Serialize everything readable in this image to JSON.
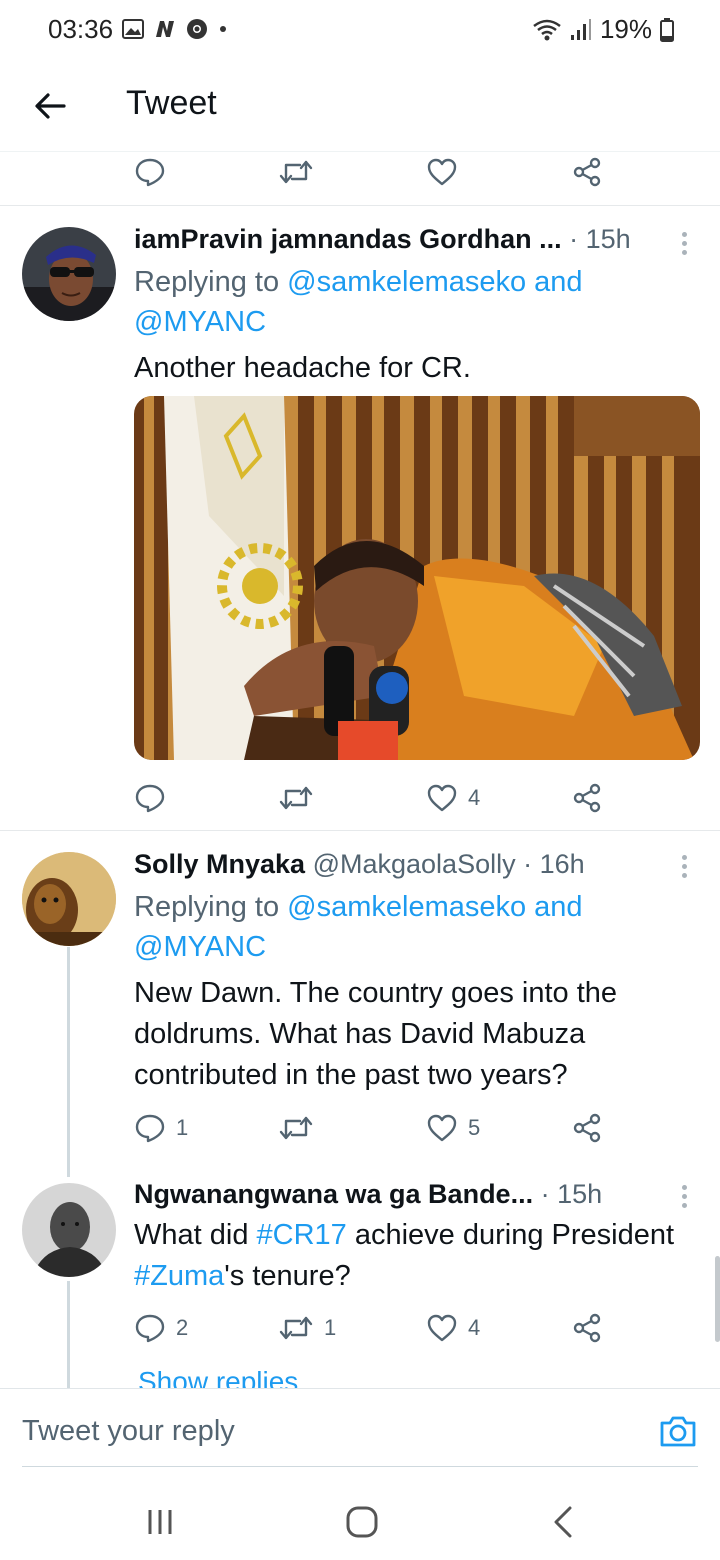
{
  "status_bar": {
    "time": "03:36",
    "battery": "19%",
    "icons": [
      "image-icon",
      "n-icon",
      "chrome-icon",
      "dot-icon",
      "wifi-icon",
      "signal-icon",
      "battery-icon"
    ]
  },
  "header": {
    "title": "Tweet",
    "back_icon": "arrow-left-icon"
  },
  "top_actions": {
    "reply_count": "",
    "retweet_count": "",
    "like_count": ""
  },
  "tweets": [
    {
      "name": "iamPravin jamnandas Gordhan ...",
      "handle": "",
      "time": "· 15h",
      "replying_prefix": "Replying to",
      "replying_mentions": "@samkelemaseko and @MYANC",
      "text": "Another headache for CR.",
      "has_image": true,
      "reply_count": "",
      "retweet_count": "",
      "like_count": "4"
    },
    {
      "name": "Solly Mnyaka",
      "handle": "@MakgaolaSolly",
      "time": "· 16h",
      "replying_prefix": "Replying to",
      "replying_mentions": "@samkelemaseko and @MYANC",
      "text": "New Dawn. The country goes into the doldrums. What has David Mabuza contributed in the past two years?",
      "reply_count": "1",
      "retweet_count": "",
      "like_count": "5"
    },
    {
      "name": "Ngwanangwana wa ga Bande...",
      "handle": "",
      "time": "· 15h",
      "text_parts": [
        "What did ",
        "#CR17",
        " achieve during President ",
        "#Zuma",
        "'s tenure?"
      ],
      "reply_count": "2",
      "retweet_count": "1",
      "like_count": "4",
      "show_replies": "Show replies"
    }
  ],
  "composer": {
    "placeholder": "Tweet your reply",
    "camera_icon": "camera-icon"
  },
  "nav": {
    "recents_icon": "recents-icon",
    "home_icon": "home-icon",
    "back_icon": "back-chevron-icon"
  },
  "colors": {
    "accent": "#1d9bf0",
    "text": "#0f1419",
    "secondary": "#536471"
  }
}
